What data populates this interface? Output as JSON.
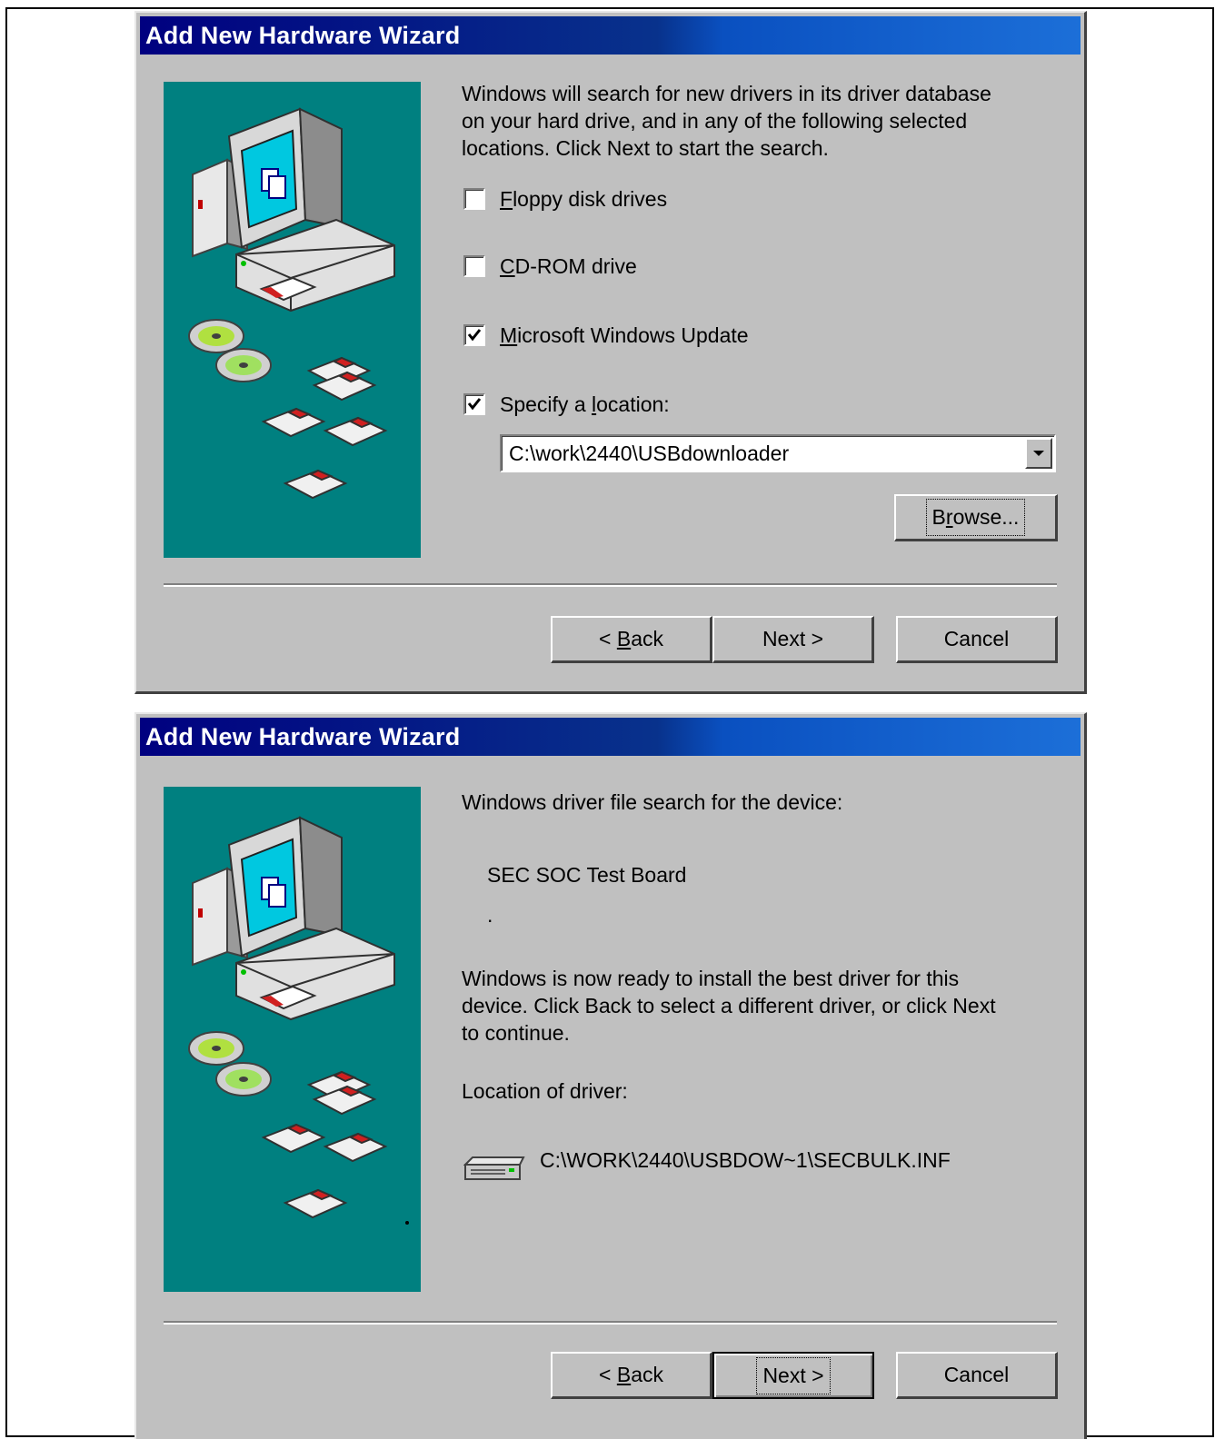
{
  "dialog1": {
    "title": "Add New Hardware Wizard",
    "intro_line1": "Windows will search for new drivers in its driver database",
    "intro_line2": "on your hard drive, and in any of the following selected",
    "intro_line3": "locations. Click Next to start the search.",
    "options": [
      {
        "hotkey": "F",
        "rest": "loppy disk drives",
        "checked": false
      },
      {
        "hotkey": "C",
        "rest": "D-ROM drive",
        "checked": false
      },
      {
        "hotkey": "M",
        "rest": "icrosoft Windows Update",
        "checked": true
      },
      {
        "pre": "Specify a ",
        "hotkey": "l",
        "rest": "ocation:",
        "checked": true
      }
    ],
    "location_value": "C:\\work\\2440\\USBdownloader",
    "browse_pre": "B",
    "browse_hotkey": "r",
    "browse_rest": "owse...",
    "back_pre": "< ",
    "back_hotkey": "B",
    "back_rest": "ack",
    "next_label": "Next >",
    "cancel_label": "Cancel"
  },
  "dialog2": {
    "title": "Add New Hardware Wizard",
    "search_label": "Windows driver file search for the device:",
    "device_name": "SEC SOC Test Board",
    "dot": ".",
    "ready_line1": "Windows is now ready to install the best driver for this",
    "ready_line2": "device. Click Back to select a different driver, or click Next",
    "ready_line3": "to continue.",
    "location_label": "Location of driver:",
    "driver_path": "C:\\WORK\\2440\\USBDOW~1\\SECBULK.INF",
    "back_pre": "< ",
    "back_hotkey": "B",
    "back_rest": "ack",
    "next_label": "Next >",
    "cancel_label": "Cancel"
  }
}
